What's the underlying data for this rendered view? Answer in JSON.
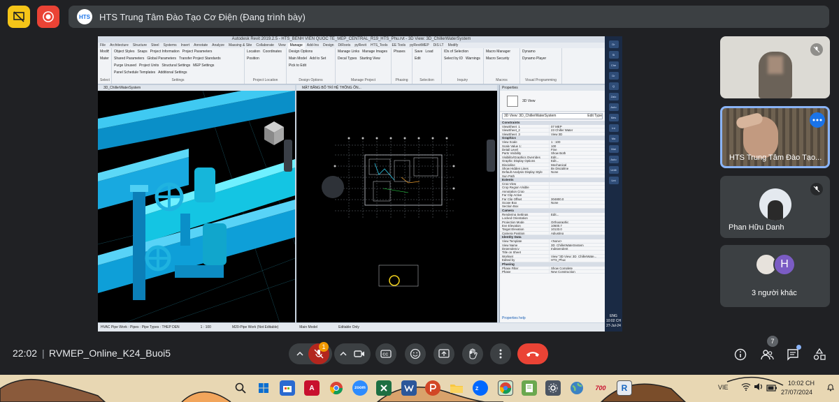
{
  "top_bar": {
    "presenter_logo": "HTS",
    "presentation_title": "HTS Trung Tâm Đào Tạo Cơ Điện (Đang trình bày)"
  },
  "revit": {
    "title": "Autodesk Revit 2019.2.5 - HTS_BENH VIEN QUOC TE_MEP_CENTRAL_R19_HTS_Phu.rvt - 3D View: 3D_ChillerWaterSystem",
    "tabs": [
      "File",
      "Architecture",
      "Structure",
      "Steel",
      "Systems",
      "Insert",
      "Annotate",
      "Analyze",
      "Massing & Site",
      "Collaborate",
      "View",
      "Manage",
      "Add-Ins",
      "Design",
      "DiRoots",
      "pyRevit",
      "HTS_Tools",
      "EE Tools",
      "pyRevitMEP",
      "DiS LT",
      "Modify"
    ],
    "active_tab": "Manage",
    "ribbon_groups": [
      {
        "title": "Select",
        "items": [
          "Modify",
          "Materials"
        ]
      },
      {
        "title": "Settings",
        "items": [
          "Object Styles",
          "Snaps",
          "Project Information",
          "Project Parameters",
          "Shared Parameters",
          "Global Parameters",
          "Transfer Project Standards",
          "Purge Unused",
          "Project Units",
          "Structural Settings",
          "MEP Settings",
          "Panel Schedule Templates",
          "Additional Settings"
        ]
      },
      {
        "title": "Project Location",
        "items": [
          "Location",
          "Coordinates",
          "Position"
        ]
      },
      {
        "title": "Design Options",
        "items": [
          "Design Options",
          "Main Model",
          "Add to Set",
          "Pick to Edit"
        ]
      },
      {
        "title": "Manage Project",
        "items": [
          "Manage Links",
          "Manage Images",
          "Decal Types",
          "Starting View"
        ]
      },
      {
        "title": "Phasing",
        "items": [
          "Phases"
        ]
      },
      {
        "title": "Selection",
        "items": [
          "Save",
          "Load",
          "Edit"
        ]
      },
      {
        "title": "Inquiry",
        "items": [
          "IDs of Selection",
          "Select by ID",
          "Warnings"
        ]
      },
      {
        "title": "Macros",
        "items": [
          "Macro Manager",
          "Macro Security"
        ]
      },
      {
        "title": "Visual Programming",
        "items": [
          "Dynamo",
          "Dynamo Player"
        ]
      }
    ],
    "left_view_title": "3D_ChillerWaterSystem",
    "mid_view_title": "MẶT BẰNG BỐ TRÍ HỆ THỐNG ỐN...",
    "properties": {
      "title": "Properties",
      "type_name": "3D View",
      "selector": "3D View: 3D_ChillerWaterSystem",
      "edit_type": "Edit Type",
      "categories": [
        {
          "name": "Constraints",
          "rows": [
            [
              "ViewSheet_1",
              "07 MEP"
            ],
            [
              "ViewSheet_2",
              "23 Chiller Water"
            ],
            [
              "ViewSheet_3",
              "View 3D"
            ]
          ]
        },
        {
          "name": "Graphics",
          "rows": [
            [
              "View Scale",
              "1 : 100"
            ],
            [
              "Scale Value 1:",
              "100"
            ],
            [
              "Detail Level",
              "Fine"
            ],
            [
              "Parts Visibility",
              "Show Both"
            ],
            [
              "Visibility/Graphics Overrides",
              "Edit..."
            ],
            [
              "Graphic Display Options",
              "Edit..."
            ],
            [
              "Discipline",
              "Mechanical"
            ],
            [
              "Show Hidden Lines",
              "By Discipline"
            ],
            [
              "Default Analysis Display Style",
              "None"
            ],
            [
              "Sun Path",
              ""
            ]
          ]
        },
        {
          "name": "Extents",
          "rows": [
            [
              "Crop View",
              ""
            ],
            [
              "Crop Region Visible",
              ""
            ],
            [
              "Annotation Crop",
              ""
            ],
            [
              "Far Clip Active",
              ""
            ],
            [
              "Far Clip Offset",
              "304800.0"
            ],
            [
              "Scope Box",
              "None"
            ],
            [
              "Section Box",
              ""
            ]
          ]
        },
        {
          "name": "Camera",
          "rows": [
            [
              "Rendering Settings",
              "Edit..."
            ],
            [
              "Locked Orientation",
              ""
            ],
            [
              "Projection Mode",
              "Orthographic"
            ],
            [
              "Eye Elevation",
              "10600.7"
            ],
            [
              "Target Elevation",
              "10133.0"
            ],
            [
              "Camera Position",
              "Adjusting"
            ]
          ]
        },
        {
          "name": "Identity Data",
          "rows": [
            [
              "View Template",
              "<None>"
            ],
            [
              "View Name",
              "3D_ChillerWaterSystem"
            ],
            [
              "Dependency",
              "Independent"
            ],
            [
              "Title on Sheet",
              ""
            ],
            [
              "Workset",
              "View \"3D View: 3D_ChillerWate..."
            ],
            [
              "Edited by",
              "HTS_Phuc"
            ]
          ]
        },
        {
          "name": "Phasing",
          "rows": [
            [
              "Phase Filter",
              "Show Complete"
            ],
            [
              "Phase",
              "New Construction"
            ]
          ]
        }
      ],
      "help": "Properties help"
    },
    "status": {
      "left": "HVAC Pipe Work : Pipes : Pipe Types : THEP DEN",
      "view_left": "1 : 100",
      "mid": "M20-Pipe Work (Not Editable)",
      "model": "Main Model",
      "editable": "Editable Only"
    },
    "side_taskbar": {
      "items": [
        "Dr",
        "Sl",
        "Che",
        "Dr",
        "Q",
        "Zalo",
        "Auto",
        "Mes",
        "Int",
        "Ma",
        "Mai",
        "Auto",
        "Untit",
        "Unt"
      ],
      "lang": "ENG",
      "time": "10:02 CH",
      "date": "27-Jul-24"
    }
  },
  "participants": [
    {
      "name": "",
      "muted": true
    },
    {
      "name": "HTS Trung Tâm Đào Tạo...",
      "muted": false,
      "speaking": true
    },
    {
      "name": "Phan Hữu Danh",
      "muted": true
    },
    {
      "name": "3 người khác",
      "others_initial": "H"
    }
  ],
  "bottom": {
    "time": "22:02",
    "separator": "|",
    "meeting_name": "RVMEP_Online_K24_Buoi5",
    "mic_badge": "1",
    "people_count": "7"
  },
  "taskbar": {
    "pinned": [
      "File Explorer",
      "Search",
      "Start",
      "Store",
      "AutoCAD",
      "Chrome",
      "Zoom",
      "Excel",
      "Word",
      "PowerPoint",
      "Folder",
      "Zalo",
      "Chrome",
      "Notes",
      "Settings",
      "Maps",
      "700",
      "Revit"
    ],
    "acad_label": "A",
    "zoom_label": "zoom",
    "badge_700": "700",
    "revit_label": "R",
    "lang": "VIE",
    "time": "10:02 CH",
    "date": "27/07/2024"
  },
  "colors": {
    "accent_yellow": "#f5c518",
    "record_red": "#ea4335",
    "leave_red": "#ea4335",
    "speaking_border": "#8ab4f8",
    "avatar_purple": "#7b5cc4"
  }
}
